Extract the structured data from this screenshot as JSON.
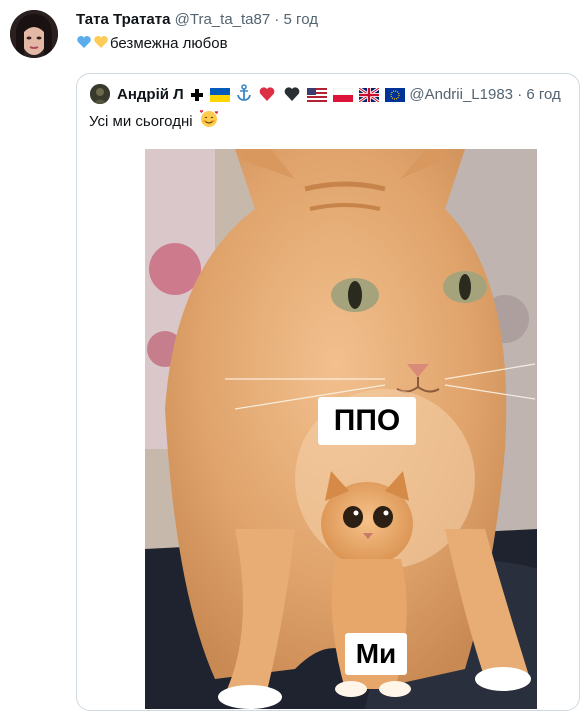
{
  "tweet": {
    "author_name": "Тата Тратата",
    "author_handle": "@Tra_ta_ta87",
    "separator": "·",
    "time": "5 год",
    "text": "безмежна любов",
    "emoji": [
      "blue-heart",
      "yellow-heart"
    ]
  },
  "quoted_tweet": {
    "author_name": "Андрій Л",
    "name_emoji": [
      "cross",
      "ukraine-flag",
      "anchor",
      "red-heart",
      "black-heart",
      "us-flag",
      "poland-flag",
      "uk-flag",
      "eu-flag"
    ],
    "author_handle": "@Andrii_L1983",
    "separator": "·",
    "time": "6 год",
    "text": "Усі ми сьогодні",
    "text_emoji": "smiling-face-with-hearts",
    "image": {
      "label_top": "ППО",
      "label_bottom": "Ми"
    }
  }
}
